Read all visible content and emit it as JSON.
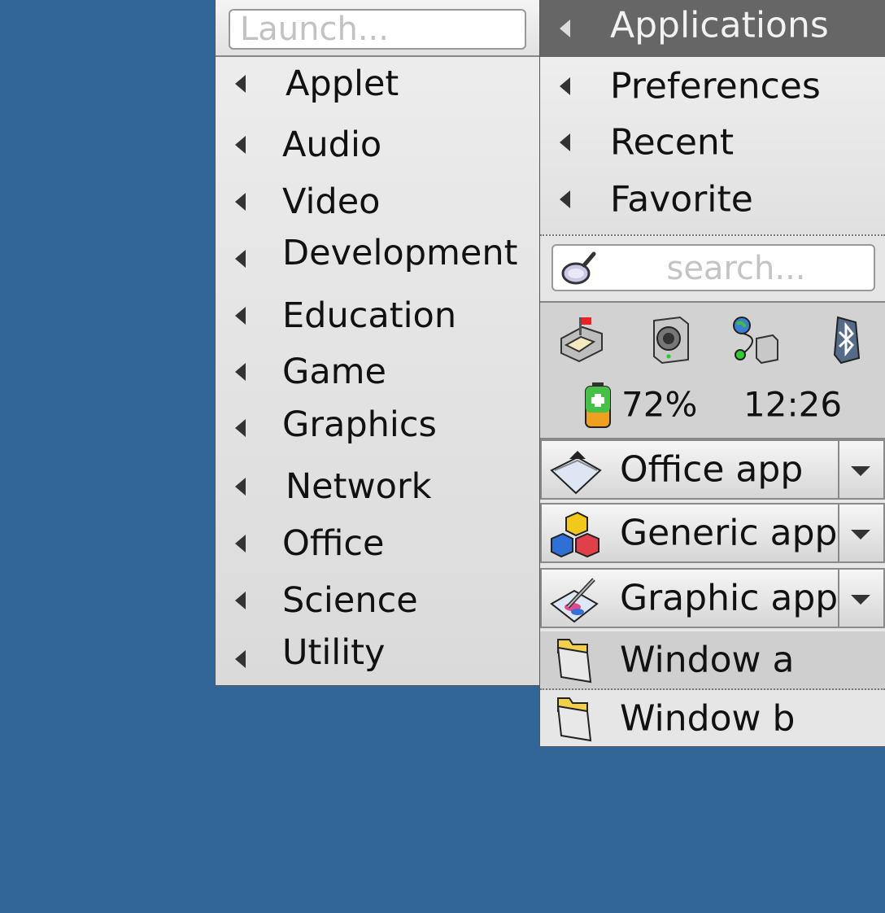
{
  "launcher": {
    "placeholder": "Launch..."
  },
  "categories": [
    {
      "label": "Applet"
    },
    {
      "label": "Audio"
    },
    {
      "label": "Video"
    },
    {
      "label": "Development"
    },
    {
      "label": "Education"
    },
    {
      "label": "Game"
    },
    {
      "label": "Graphics"
    },
    {
      "label": "Network"
    },
    {
      "label": "Office"
    },
    {
      "label": "Science"
    },
    {
      "label": "Utility"
    }
  ],
  "applications_header": {
    "label": "Applications"
  },
  "places": [
    {
      "label": "Preferences"
    },
    {
      "label": "Recent"
    },
    {
      "label": "Favorite"
    }
  ],
  "search": {
    "placeholder": "search..."
  },
  "tray": {
    "icons": [
      "mail-icon",
      "speaker-icon",
      "network-icon",
      "bluetooth-icon"
    ],
    "battery": "72%",
    "clock": "12:26"
  },
  "tasks": [
    {
      "label": "Office app",
      "icon": "office-app-icon"
    },
    {
      "label": "Generic app",
      "icon": "generic-app-icon"
    },
    {
      "label": "Graphic app",
      "icon": "graphic-app-icon"
    }
  ],
  "windows": [
    {
      "label": "Window a"
    },
    {
      "label": "Window b"
    }
  ],
  "colors": {
    "desktop": "#326699",
    "header": "#666666",
    "panel": "#e6e6e6"
  }
}
